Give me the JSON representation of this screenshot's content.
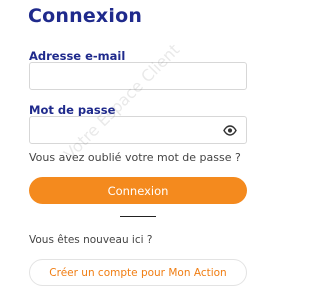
{
  "page": {
    "title": "Connexion"
  },
  "form": {
    "email_label": "Adresse e-mail",
    "email_value": "",
    "password_label": "Mot de passe",
    "password_value": "",
    "forgot_link": "Vous avez oublié votre mot de passe ?",
    "login_button": "Connexion"
  },
  "signup": {
    "prompt": "Vous êtes nouveau ici ?",
    "create_button": "Créer un compte pour Mon Action"
  },
  "watermark": {
    "text": "Votre Espace Client"
  },
  "icons": {
    "password_toggle": "eye-icon"
  },
  "colors": {
    "heading": "#1f2a8c",
    "accent": "#f48a1e",
    "create_text": "#f07d12"
  }
}
